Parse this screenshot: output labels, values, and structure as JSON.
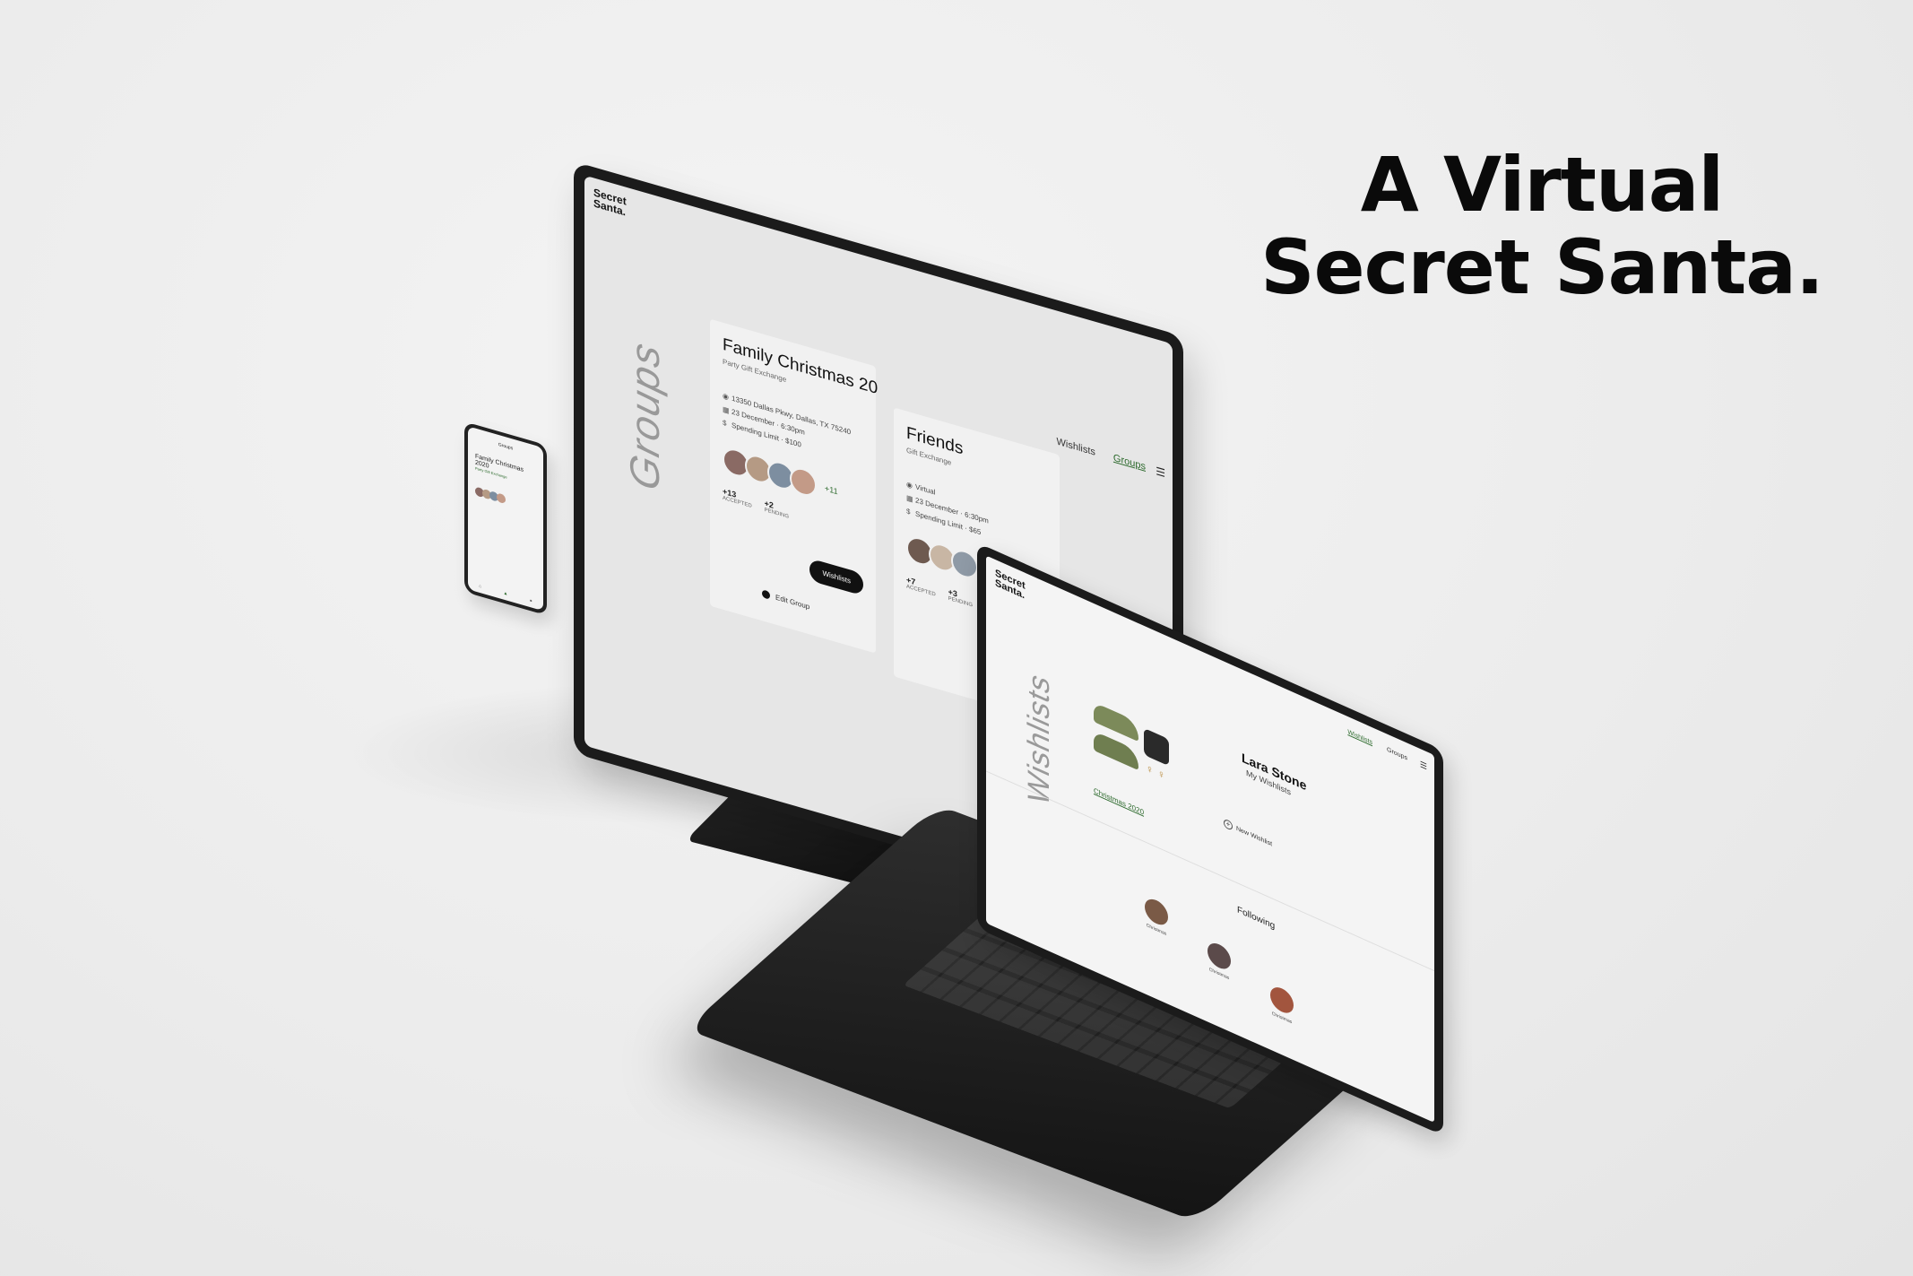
{
  "headline": {
    "line1": "A Virtual",
    "line2": "Secret Santa."
  },
  "desktop": {
    "logo": "Secret Santa.",
    "nav": [
      "Wishlists",
      "Groups"
    ],
    "section_title": "Groups",
    "cards": [
      {
        "title": "Family Christmas 20",
        "subtitle": "Party Gift Exchange",
        "address": "13350 Dallas Pkwy, Dallas, TX 75240",
        "date": "23 December",
        "time": "6:30pm",
        "spending_label": "Spending Limit",
        "spending": "$100",
        "more_count": "+11",
        "accepted_count": "+13",
        "accepted_label": "ACCEPTED",
        "pending_count": "+2",
        "pending_label": "PENDING",
        "button": "Wishlists",
        "edit": "Edit Group"
      },
      {
        "title": "Friends",
        "subtitle": "Gift Exchange",
        "location": "Virtual",
        "date": "23 December",
        "time": "6:30pm",
        "spending_label": "Spending Limit",
        "spending": "$65",
        "accepted_count": "+7",
        "accepted_label": "ACCEPTED",
        "pending_count": "+3",
        "pending_label": "PENDING"
      }
    ]
  },
  "phone": {
    "title": "Groups",
    "card_title": "Family Christmas 2020",
    "card_subtitle": "Party Gift Exchange"
  },
  "laptop": {
    "logo": "Secret Santa.",
    "nav": [
      "Wishlists",
      "Groups"
    ],
    "section_title": "Wishlists",
    "user_name": "Lara Stone",
    "user_subtitle": "My Wishlists",
    "product_link": "Christmas 2020",
    "new_wishlist": "New Wishlist",
    "following_title": "Following",
    "following": [
      {
        "name": "Christmas"
      },
      {
        "name": "Christmas"
      },
      {
        "name": "Christmas"
      }
    ]
  },
  "colors": {
    "accent_green": "#2d6a2d",
    "dark": "#111111",
    "screen_bg": "#f4f4f4"
  }
}
